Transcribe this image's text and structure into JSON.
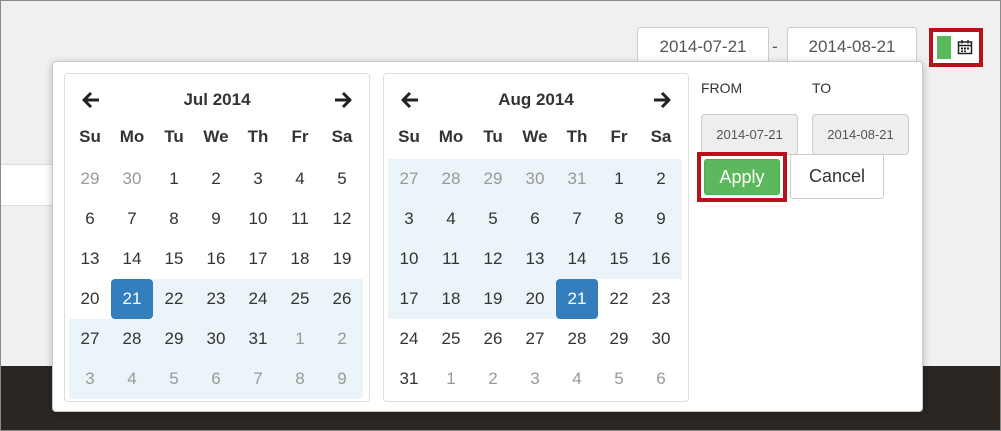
{
  "header": {
    "start_date": "2014-07-21",
    "end_date": "2014-08-21",
    "separator": "-"
  },
  "weekdays": [
    "Su",
    "Mo",
    "Tu",
    "We",
    "Th",
    "Fr",
    "Sa"
  ],
  "left_calendar": {
    "title": "Jul 2014",
    "days": [
      {
        "d": "29",
        "off": true,
        "in": false,
        "active": false
      },
      {
        "d": "30",
        "off": true,
        "in": false,
        "active": false
      },
      {
        "d": "1",
        "off": false,
        "in": false,
        "active": false
      },
      {
        "d": "2",
        "off": false,
        "in": false,
        "active": false
      },
      {
        "d": "3",
        "off": false,
        "in": false,
        "active": false
      },
      {
        "d": "4",
        "off": false,
        "in": false,
        "active": false
      },
      {
        "d": "5",
        "off": false,
        "in": false,
        "active": false
      },
      {
        "d": "6",
        "off": false,
        "in": false,
        "active": false
      },
      {
        "d": "7",
        "off": false,
        "in": false,
        "active": false
      },
      {
        "d": "8",
        "off": false,
        "in": false,
        "active": false
      },
      {
        "d": "9",
        "off": false,
        "in": false,
        "active": false
      },
      {
        "d": "10",
        "off": false,
        "in": false,
        "active": false
      },
      {
        "d": "11",
        "off": false,
        "in": false,
        "active": false
      },
      {
        "d": "12",
        "off": false,
        "in": false,
        "active": false
      },
      {
        "d": "13",
        "off": false,
        "in": false,
        "active": false
      },
      {
        "d": "14",
        "off": false,
        "in": false,
        "active": false
      },
      {
        "d": "15",
        "off": false,
        "in": false,
        "active": false
      },
      {
        "d": "16",
        "off": false,
        "in": false,
        "active": false
      },
      {
        "d": "17",
        "off": false,
        "in": false,
        "active": false
      },
      {
        "d": "18",
        "off": false,
        "in": false,
        "active": false
      },
      {
        "d": "19",
        "off": false,
        "in": false,
        "active": false
      },
      {
        "d": "20",
        "off": false,
        "in": false,
        "active": false
      },
      {
        "d": "21",
        "off": false,
        "in": false,
        "active": true
      },
      {
        "d": "22",
        "off": false,
        "in": true,
        "active": false
      },
      {
        "d": "23",
        "off": false,
        "in": true,
        "active": false
      },
      {
        "d": "24",
        "off": false,
        "in": true,
        "active": false
      },
      {
        "d": "25",
        "off": false,
        "in": true,
        "active": false
      },
      {
        "d": "26",
        "off": false,
        "in": true,
        "active": false
      },
      {
        "d": "27",
        "off": false,
        "in": true,
        "active": false
      },
      {
        "d": "28",
        "off": false,
        "in": true,
        "active": false
      },
      {
        "d": "29",
        "off": false,
        "in": true,
        "active": false
      },
      {
        "d": "30",
        "off": false,
        "in": true,
        "active": false
      },
      {
        "d": "31",
        "off": false,
        "in": true,
        "active": false
      },
      {
        "d": "1",
        "off": true,
        "in": true,
        "active": false
      },
      {
        "d": "2",
        "off": true,
        "in": true,
        "active": false
      },
      {
        "d": "3",
        "off": true,
        "in": true,
        "active": false
      },
      {
        "d": "4",
        "off": true,
        "in": true,
        "active": false
      },
      {
        "d": "5",
        "off": true,
        "in": true,
        "active": false
      },
      {
        "d": "6",
        "off": true,
        "in": true,
        "active": false
      },
      {
        "d": "7",
        "off": true,
        "in": true,
        "active": false
      },
      {
        "d": "8",
        "off": true,
        "in": true,
        "active": false
      },
      {
        "d": "9",
        "off": true,
        "in": true,
        "active": false
      }
    ]
  },
  "right_calendar": {
    "title": "Aug 2014",
    "days": [
      {
        "d": "27",
        "off": true,
        "in": true,
        "active": false
      },
      {
        "d": "28",
        "off": true,
        "in": true,
        "active": false
      },
      {
        "d": "29",
        "off": true,
        "in": true,
        "active": false
      },
      {
        "d": "30",
        "off": true,
        "in": true,
        "active": false
      },
      {
        "d": "31",
        "off": true,
        "in": true,
        "active": false
      },
      {
        "d": "1",
        "off": false,
        "in": true,
        "active": false
      },
      {
        "d": "2",
        "off": false,
        "in": true,
        "active": false
      },
      {
        "d": "3",
        "off": false,
        "in": true,
        "active": false
      },
      {
        "d": "4",
        "off": false,
        "in": true,
        "active": false
      },
      {
        "d": "5",
        "off": false,
        "in": true,
        "active": false
      },
      {
        "d": "6",
        "off": false,
        "in": true,
        "active": false
      },
      {
        "d": "7",
        "off": false,
        "in": true,
        "active": false
      },
      {
        "d": "8",
        "off": false,
        "in": true,
        "active": false
      },
      {
        "d": "9",
        "off": false,
        "in": true,
        "active": false
      },
      {
        "d": "10",
        "off": false,
        "in": true,
        "active": false
      },
      {
        "d": "11",
        "off": false,
        "in": true,
        "active": false
      },
      {
        "d": "12",
        "off": false,
        "in": true,
        "active": false
      },
      {
        "d": "13",
        "off": false,
        "in": true,
        "active": false
      },
      {
        "d": "14",
        "off": false,
        "in": true,
        "active": false
      },
      {
        "d": "15",
        "off": false,
        "in": true,
        "active": false
      },
      {
        "d": "16",
        "off": false,
        "in": true,
        "active": false
      },
      {
        "d": "17",
        "off": false,
        "in": true,
        "active": false
      },
      {
        "d": "18",
        "off": false,
        "in": true,
        "active": false
      },
      {
        "d": "19",
        "off": false,
        "in": true,
        "active": false
      },
      {
        "d": "20",
        "off": false,
        "in": true,
        "active": false
      },
      {
        "d": "21",
        "off": false,
        "in": false,
        "active": true
      },
      {
        "d": "22",
        "off": false,
        "in": false,
        "active": false
      },
      {
        "d": "23",
        "off": false,
        "in": false,
        "active": false
      },
      {
        "d": "24",
        "off": false,
        "in": false,
        "active": false
      },
      {
        "d": "25",
        "off": false,
        "in": false,
        "active": false
      },
      {
        "d": "26",
        "off": false,
        "in": false,
        "active": false
      },
      {
        "d": "27",
        "off": false,
        "in": false,
        "active": false
      },
      {
        "d": "28",
        "off": false,
        "in": false,
        "active": false
      },
      {
        "d": "29",
        "off": false,
        "in": false,
        "active": false
      },
      {
        "d": "30",
        "off": false,
        "in": false,
        "active": false
      },
      {
        "d": "31",
        "off": false,
        "in": false,
        "active": false
      },
      {
        "d": "1",
        "off": true,
        "in": false,
        "active": false
      },
      {
        "d": "2",
        "off": true,
        "in": false,
        "active": false
      },
      {
        "d": "3",
        "off": true,
        "in": false,
        "active": false
      },
      {
        "d": "4",
        "off": true,
        "in": false,
        "active": false
      },
      {
        "d": "5",
        "off": true,
        "in": false,
        "active": false
      },
      {
        "d": "6",
        "off": true,
        "in": false,
        "active": false
      }
    ]
  },
  "range": {
    "from_label": "FROM",
    "to_label": "TO",
    "from_value": "2014-07-21",
    "to_value": "2014-08-21"
  },
  "buttons": {
    "apply": "Apply",
    "cancel": "Cancel"
  },
  "icons": {
    "toggle": "calendar-icon",
    "prev": "arrow-left-icon",
    "next": "arrow-right-icon"
  },
  "colors": {
    "accent_green": "#5cb85c",
    "active_blue": "#357ebd",
    "range_bg": "#ebf4f8",
    "highlight_red": "#b5121b"
  }
}
